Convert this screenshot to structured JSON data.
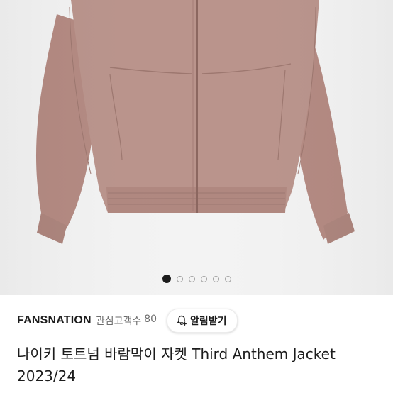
{
  "product_image": {
    "alt": "",
    "slide_count": 6,
    "active_slide": 1
  },
  "shop": {
    "name": "FANSNATION",
    "followers_label": "관심고객수",
    "followers_count": "80",
    "alert_button_label": "알림받기"
  },
  "listing": {
    "title_line1": "나이키 토트넘 바람막이 자켓 Third Anthem Jacket",
    "title_line2": "2023/24"
  },
  "colors": {
    "jacket": "#b68e86",
    "background": "#f3f3f3"
  }
}
